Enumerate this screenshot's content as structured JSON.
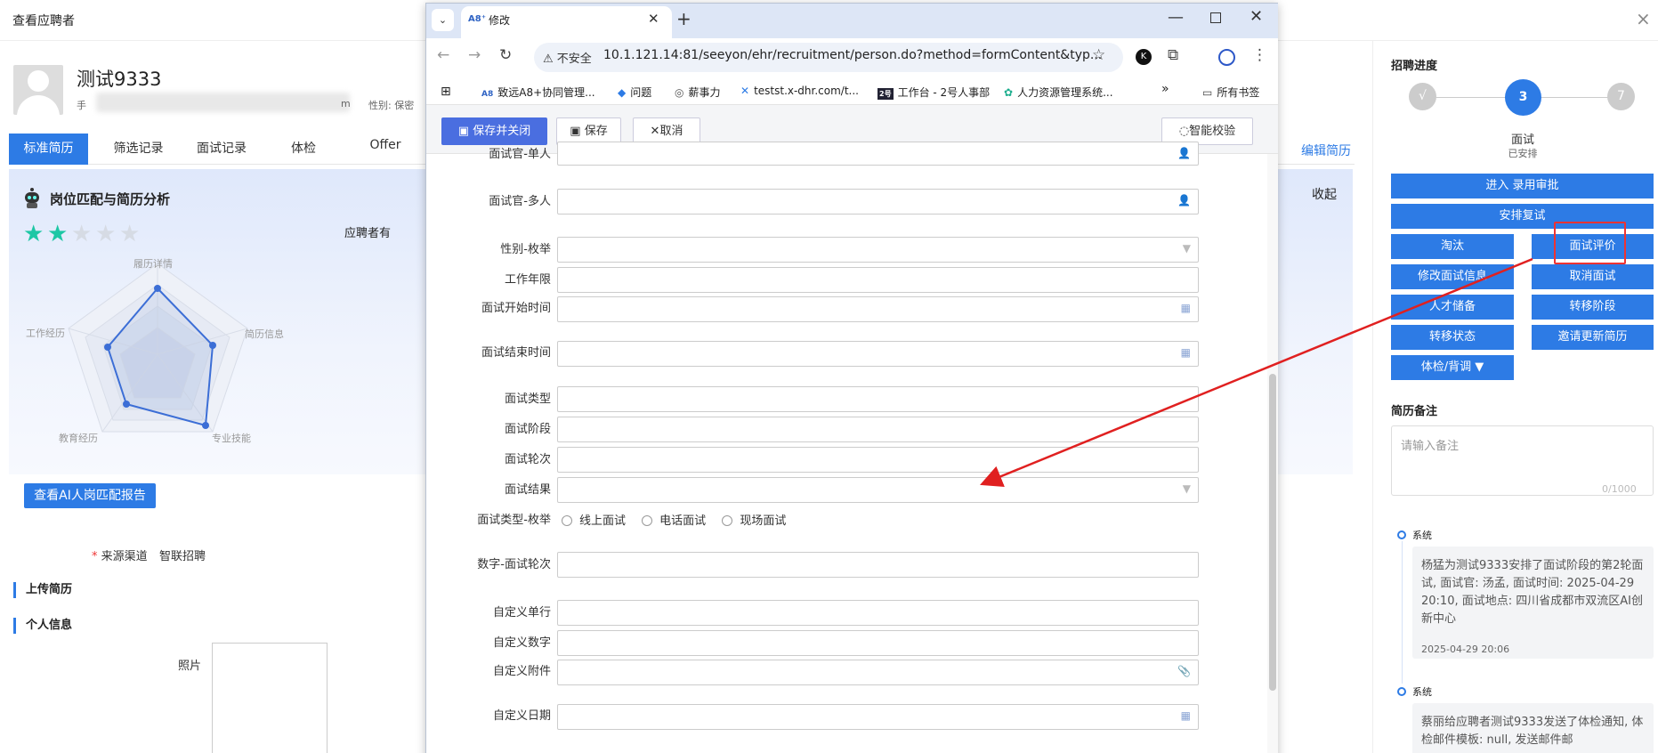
{
  "page": {
    "title": "查看应聘者",
    "close_icon": "×"
  },
  "candidate": {
    "name": "测试9333",
    "phone_label": "手",
    "email_suffix": "m",
    "gender": "性别: 保密"
  },
  "tabs": [
    {
      "label": "标准简历",
      "active": true
    },
    {
      "label": "筛选记录"
    },
    {
      "label": "面试记录"
    },
    {
      "label": "体检"
    },
    {
      "label": "Offer"
    }
  ],
  "edit_resume": "编辑简历",
  "match": {
    "title": "岗位匹配与简历分析",
    "collapse": "收起",
    "stars": 2,
    "stars_max": 5,
    "applicant_has": "应聘者有",
    "radar_labels": [
      "履历详情",
      "简历信息",
      "专业技能",
      "教育经历",
      "工作经历"
    ],
    "report_button": "查看AI人岗匹配报告"
  },
  "source": {
    "required_mark": "*",
    "label": "来源渠道",
    "value": "智联招聘"
  },
  "sections": {
    "upload": "上传简历",
    "personal": "个人信息",
    "photo": "照片"
  },
  "progress": {
    "title": "招聘进度",
    "steps": [
      {
        "label": "√"
      },
      {
        "label": "3"
      },
      {
        "label": "7"
      }
    ],
    "current_stage": "面试",
    "current_status": "已安排"
  },
  "actions": {
    "enter_hire": "进入 录用审批",
    "arrange_retest": "安排复试",
    "eliminate": "淘汰",
    "interview_eval": "面试评价",
    "modify_interview": "修改面试信息",
    "cancel_interview": "取消面试",
    "talent_reserve": "人才储备",
    "transfer_stage": "转移阶段",
    "transfer_status": "转移状态",
    "invite_update": "邀请更新简历",
    "physical_check": "体检/背调 ▼"
  },
  "notes": {
    "title": "简历备注",
    "placeholder": "请输入备注",
    "count": "0/1000"
  },
  "timeline": [
    {
      "author": "系统",
      "text": "杨猛为测试9333安排了面试阶段的第2轮面试, 面试官: 汤孟, 面试时间: 2025-04-29 20:10, 面试地点: 四川省成都市双流区AI创新中心",
      "time": "2025-04-29 20:06"
    },
    {
      "author": "系统",
      "text": "蔡丽给应聘者测试9333发送了体检通知, 体检邮件模板: null, 发送邮件邮"
    }
  ],
  "browser": {
    "tab_title": "修改",
    "tab_logo": "A8⁺",
    "tab_dropdown_icon": "⌄",
    "new_tab_icon": "+",
    "insecure": "不安全",
    "url": "10.1.121.14:81/seeyon/ehr/recruitment/person.do?method=formContent&typ...",
    "bookmarks": [
      {
        "label": "致远A8+协同管理...",
        "icon": "A8"
      },
      {
        "label": "问题",
        "icon": "◆"
      },
      {
        "label": "薪事力",
        "icon": "◎"
      },
      {
        "label": "testst.x-dhr.com/t...",
        "icon": "✕"
      },
      {
        "label": "工作台 - 2号人事部",
        "icon": "2号"
      },
      {
        "label": "人力资源管理系统...",
        "icon": "✿"
      }
    ],
    "more_bookmarks": "»",
    "all_bookmarks": "所有书签"
  },
  "form_toolbar": {
    "save_close": "保存并关闭",
    "save": "保存",
    "cancel": "取消",
    "smart_check": "智能校验"
  },
  "form_fields": [
    {
      "label": "面试官-单人"
    },
    {
      "label": "面试官-多人"
    },
    {
      "label": "性别-枚举"
    },
    {
      "label": "工作年限"
    },
    {
      "label": "面试开始时间"
    },
    {
      "label": "面试结束时间"
    },
    {
      "label": "面试类型"
    },
    {
      "label": "面试阶段"
    },
    {
      "label": "面试轮次"
    },
    {
      "label": "面试结果"
    },
    {
      "label": "面试类型-枚举"
    },
    {
      "label": "数字-面试轮次"
    },
    {
      "label": "自定义单行"
    },
    {
      "label": "自定义数字"
    },
    {
      "label": "自定义附件"
    },
    {
      "label": "自定义日期"
    }
  ],
  "interview_type_options": [
    "线上面试",
    "电话面试",
    "现场面试"
  ]
}
